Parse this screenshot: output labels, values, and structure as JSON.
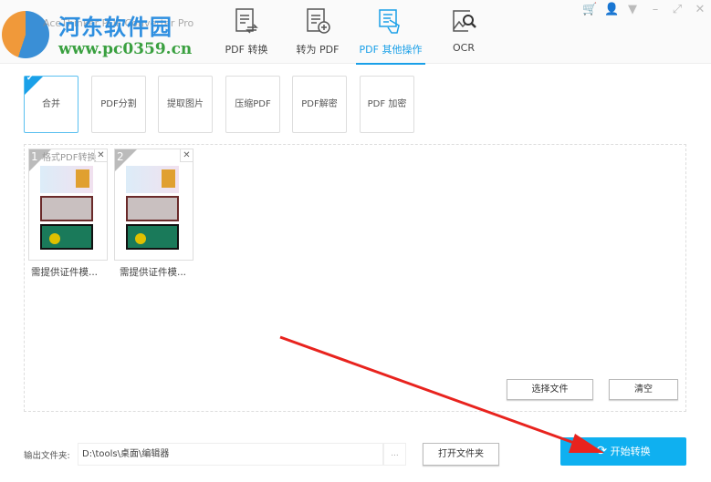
{
  "app": {
    "title": "AceThinker PDF Converter Pro",
    "watermark_cn": "河东软件园",
    "watermark_url": "www.pc0359.cn"
  },
  "tabs": [
    {
      "label": "PDF 转换",
      "icon": "pdf-convert-icon"
    },
    {
      "label": "转为 PDF",
      "icon": "to-pdf-icon"
    },
    {
      "label": "PDF 其他操作",
      "icon": "pdf-other-icon",
      "active": true
    },
    {
      "label": "OCR",
      "icon": "ocr-icon"
    }
  ],
  "window_controls": {
    "cart": "🛒",
    "user": "👤",
    "menu": "▼",
    "minimize": "–",
    "restore": "⤢",
    "close": "✕"
  },
  "operations": [
    {
      "label": "合并",
      "active": true
    },
    {
      "label": "PDF分割"
    },
    {
      "label": "提取图片"
    },
    {
      "label": "压缩PDF"
    },
    {
      "label": "PDF解密"
    },
    {
      "label": "PDF 加密"
    }
  ],
  "files": [
    {
      "num": "1",
      "name": "需提供证件模...",
      "overlay": "格式PDF转换"
    },
    {
      "num": "2",
      "name": "需提供证件模..."
    }
  ],
  "actions": {
    "select": "选择文件",
    "clear": "清空"
  },
  "output": {
    "label": "输出文件夹:",
    "path": "D:\\tools\\桌面\\编辑器",
    "browse": "...",
    "open": "打开文件夹",
    "start": "开始转换"
  },
  "colors": {
    "accent": "#1aa0e8",
    "start": "#0fb0f0",
    "arrow": "#e8231e"
  }
}
